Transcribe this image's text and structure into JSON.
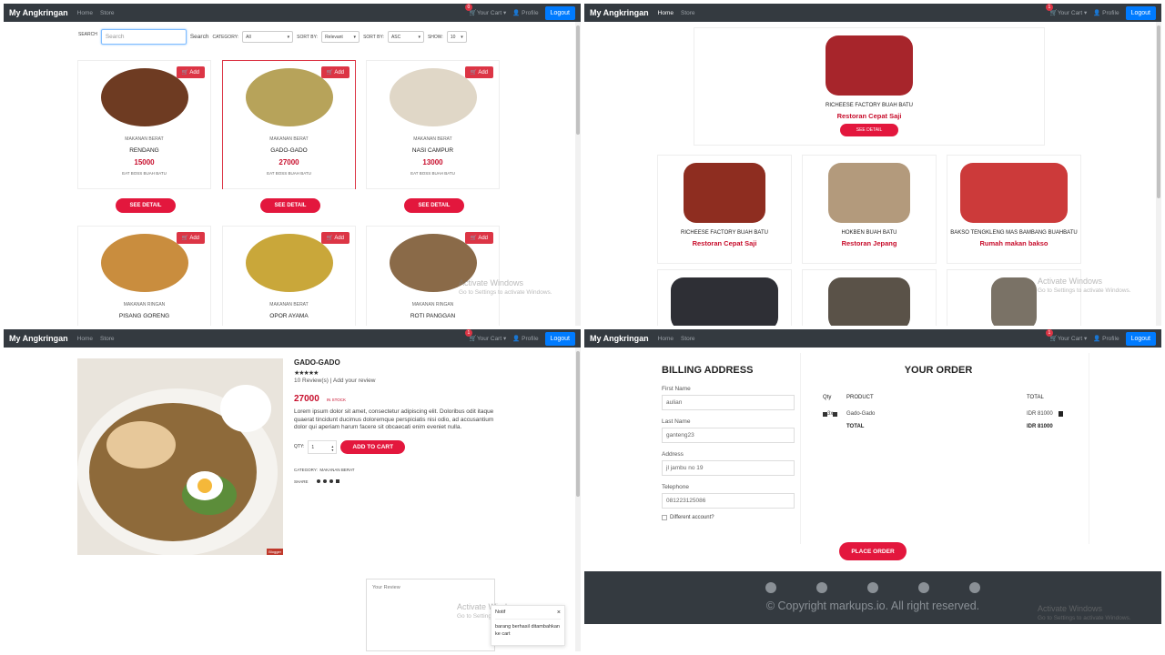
{
  "nav": {
    "brand": "My Angkringan",
    "home": "Home",
    "store": "Store",
    "cart_count": "0",
    "cart_label": "Your Cart",
    "cart_count2": "1",
    "profile": "Profile",
    "logout": "Logout"
  },
  "filter": {
    "search_label": "SEARCH",
    "search_placeholder": "Search",
    "search_btn": "Search",
    "category_label": "CATEGORY:",
    "category_value": "All",
    "sortby_label": "SORT BY:",
    "sortby_value": "Relevant",
    "sortby2_label": "SORT BY:",
    "sortby2_value": "ASC",
    "show_label": "SHOW:",
    "show_value": "10"
  },
  "products": [
    {
      "add": "Add",
      "category": "MAKANAN BERAT",
      "name": "RENDANG",
      "price": "15000",
      "shop": "EAT BOSS BUAH BATU",
      "detail": "SEE DETAIL",
      "img_color": "#6e3b22"
    },
    {
      "add": "Add",
      "category": "MAKANAN BERAT",
      "name": "GADO-GADO",
      "price": "27000",
      "shop": "EAT BOSS BUAH BATU",
      "detail": "SEE DETAIL",
      "img_color": "#b7a35a"
    },
    {
      "add": "Add",
      "category": "MAKANAN BERAT",
      "name": "NASI CAMPUR",
      "price": "13000",
      "shop": "EAT BOSS BUAH BATU",
      "detail": "SEE DETAIL",
      "img_color": "#e0d7c7"
    },
    {
      "add": "Add",
      "category": "MAKANAN RINGAN",
      "name": "PISANG GORENG",
      "img_color": "#c98d3e"
    },
    {
      "add": "Add",
      "category": "MAKANAN BERAT",
      "name": "OPOR AYAMA",
      "img_color": "#c9a73a"
    },
    {
      "add": "Add",
      "category": "MAKANAN RINGAN",
      "name": "ROTI PANGGAN",
      "img_color": "#8a6a48"
    }
  ],
  "stores": [
    {
      "name": "RICHEESE FACTORY BUAH BATU",
      "type": "Restoran Cepat Saji",
      "detail": "SEE DETAIL",
      "img_color": "#a7252b"
    },
    {
      "name": "RICHEESE FACTORY BUAH BATU",
      "type": "Restoran Cepat Saji",
      "img_color": "#8e2d20"
    },
    {
      "name": "HOKBEN BUAH BATU",
      "type": "Restoran Jepang",
      "img_color": "#b39a7c"
    },
    {
      "name": "BAKSO TENGKLENG MAS BAMBANG BUAHBATU",
      "type": "Rumah makan bakso",
      "img_color": "#cc3a3a"
    },
    {
      "img_color": "#2e2f35"
    },
    {
      "img_color": "#5a5248"
    },
    {
      "img_color": "#7a7266"
    }
  ],
  "detail": {
    "title": "GADO-GADO",
    "stars": "★★★★★",
    "reviews": "10 Review(s) | Add your review",
    "price": "27000",
    "stock": "IN STOCK",
    "desc": "Lorem ipsum dolor sit amet, consectetur adipiscing elit. Doloribus odit itaque quaerat tincidunt ducimus doloremque perspiciatis nisi odio, ad accusantium dolor qui aperiam harum facere sit obcaecati enim eveniet nulla.",
    "qty_label": "QTY:",
    "qty_value": "1",
    "add_to_cart": "ADD TO CART",
    "category_label": "CATEGORY:",
    "category_value": "MAKANAN BERAT",
    "share_label": "SHARE",
    "review_placeholder": "Your Review",
    "toast_title": "Notif",
    "toast_body": "barang berhasil ditambahkan ke cart",
    "img_tag": "Blogger",
    "img_color": "#d6c7a7"
  },
  "checkout": {
    "billing_title": "BILLING ADDRESS",
    "order_title": "YOUR ORDER",
    "fields": [
      {
        "label": "First Name",
        "value": "aulian"
      },
      {
        "label": "Last Name",
        "value": "ganteng23"
      },
      {
        "label": "Address",
        "value": "jl jambu no 19"
      },
      {
        "label": "Telephone",
        "value": "081223125086"
      }
    ],
    "diff_account": "Different account?",
    "col_qty": "Qty",
    "col_product": "PRODUCT",
    "col_total": "TOTAL",
    "item_qty": "3x",
    "item_name": "Gado-Gado",
    "item_price": "IDR 81000",
    "total_label": "TOTAL",
    "total_value": "IDR 81000",
    "place_order": "PLACE ORDER",
    "copyright": "© Copyright markups.io. All right reserved."
  },
  "watermark": {
    "title": "Activate Windows",
    "sub": "Go to Settings to activate Windows."
  }
}
